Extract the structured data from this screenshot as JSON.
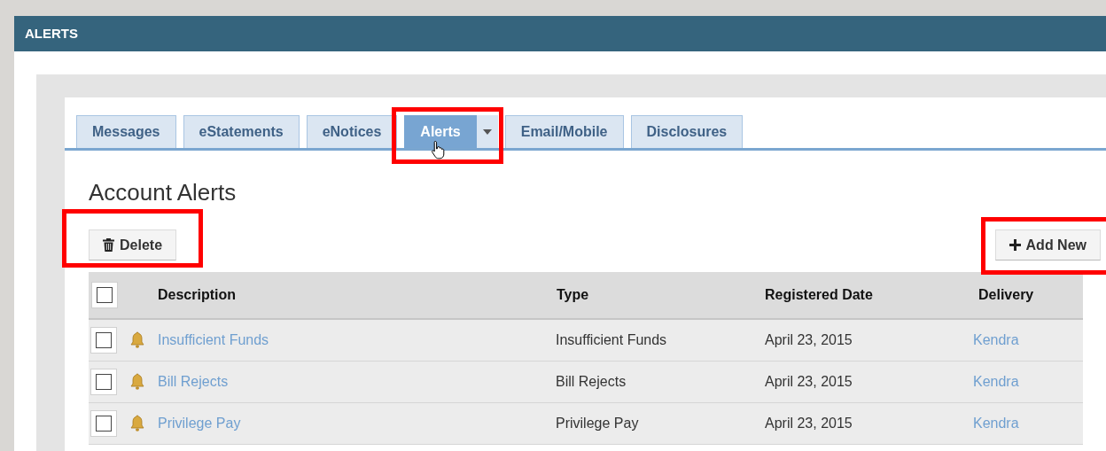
{
  "header": {
    "title": "ALERTS"
  },
  "tabs": [
    {
      "label": "Messages",
      "selected": false,
      "dropdown": false,
      "highlighted": false,
      "pointer": false
    },
    {
      "label": "eStatements",
      "selected": false,
      "dropdown": false,
      "highlighted": false,
      "pointer": false
    },
    {
      "label": "eNotices",
      "selected": false,
      "dropdown": false,
      "highlighted": false,
      "pointer": false
    },
    {
      "label": "Alerts",
      "selected": true,
      "dropdown": true,
      "highlighted": true,
      "pointer": true
    },
    {
      "label": "Email/Mobile",
      "selected": false,
      "dropdown": false,
      "highlighted": false,
      "pointer": false
    },
    {
      "label": "Disclosures",
      "selected": false,
      "dropdown": false,
      "highlighted": false,
      "pointer": false
    }
  ],
  "page_title": "Account Alerts",
  "toolbar": [
    {
      "kind": "delete",
      "label": "Delete",
      "highlighted": true
    },
    {
      "kind": "add",
      "label": "Add New",
      "highlighted": true
    }
  ],
  "table": {
    "select_all": {
      "checked": false
    },
    "columns": [
      "Description",
      "Type",
      "Registered Date",
      "Delivery"
    ],
    "rows": [
      {
        "checked": false,
        "description": "Insufficient Funds",
        "type": "Insufficient Funds",
        "registered_date": "April 23, 2015",
        "delivery": "Kendra"
      },
      {
        "checked": false,
        "description": "Bill Rejects",
        "type": "Bill Rejects",
        "registered_date": "April 23, 2015",
        "delivery": "Kendra"
      },
      {
        "checked": false,
        "description": "Privilege Pay",
        "type": "Privilege Pay",
        "registered_date": "April 23, 2015",
        "delivery": "Kendra"
      }
    ]
  }
}
